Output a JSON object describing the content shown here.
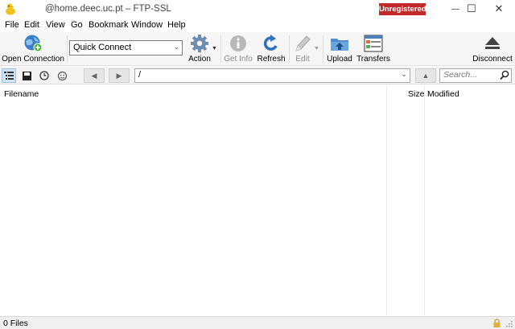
{
  "titlebar": {
    "title": "@home.deec.uc.pt – FTP-SSL",
    "badge": "Unregistered",
    "badge_color": "#c0282c",
    "minimize_glyph": "—",
    "maximize_glyph": "☐",
    "close_glyph": "✕"
  },
  "menu": {
    "items": [
      "File",
      "Edit",
      "View",
      "Go",
      "Bookmark",
      "Window",
      "Help"
    ]
  },
  "toolbar": {
    "open_connection": "Open Connection",
    "quick_connect": "Quick Connect",
    "action": "Action",
    "get_info": "Get Info",
    "refresh": "Refresh",
    "edit": "Edit",
    "upload": "Upload",
    "transfers": "Transfers",
    "disconnect": "Disconnect"
  },
  "pathbar": {
    "path": "/",
    "search_placeholder": "Search..."
  },
  "filelist": {
    "columns": [
      "Filename",
      "Size",
      "Modified"
    ]
  },
  "status": {
    "text": "0 Files"
  }
}
